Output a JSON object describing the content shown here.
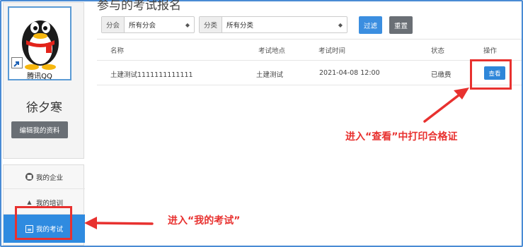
{
  "profile": {
    "avatar_caption": "腾讯QQ",
    "username": "徐夕寒",
    "edit_button": "编辑我的资料"
  },
  "nav": {
    "items": [
      {
        "label": "我的企业",
        "icon": "building-icon"
      },
      {
        "label": "我的培训",
        "icon": "graduation-cap-icon"
      },
      {
        "label": "我的考试",
        "icon": "exam-list-icon",
        "active": true
      }
    ]
  },
  "page": {
    "title": "参与的考试报名"
  },
  "filters": {
    "branch_label": "分会",
    "branch_value": "所有分会",
    "category_label": "分类",
    "category_value": "所有分类",
    "filter_button": "过滤",
    "reset_button": "重置"
  },
  "table": {
    "headers": [
      "名称",
      "考试地点",
      "考试时间",
      "状态",
      "操作"
    ],
    "rows": [
      {
        "name": "土建测试1111111111111",
        "location": "土建测试",
        "time": "2021-04-08 12:00",
        "status": "已缴费",
        "action": "查看"
      }
    ]
  },
  "annotations": {
    "view_hint": "进入“查看”中打印合格证",
    "exam_hint": "进入“我的考试”",
    "color": "#e8312f"
  },
  "colors": {
    "primary": "#2e86d9",
    "secondary": "#6a6f75",
    "frame": "#4a8bd4"
  }
}
